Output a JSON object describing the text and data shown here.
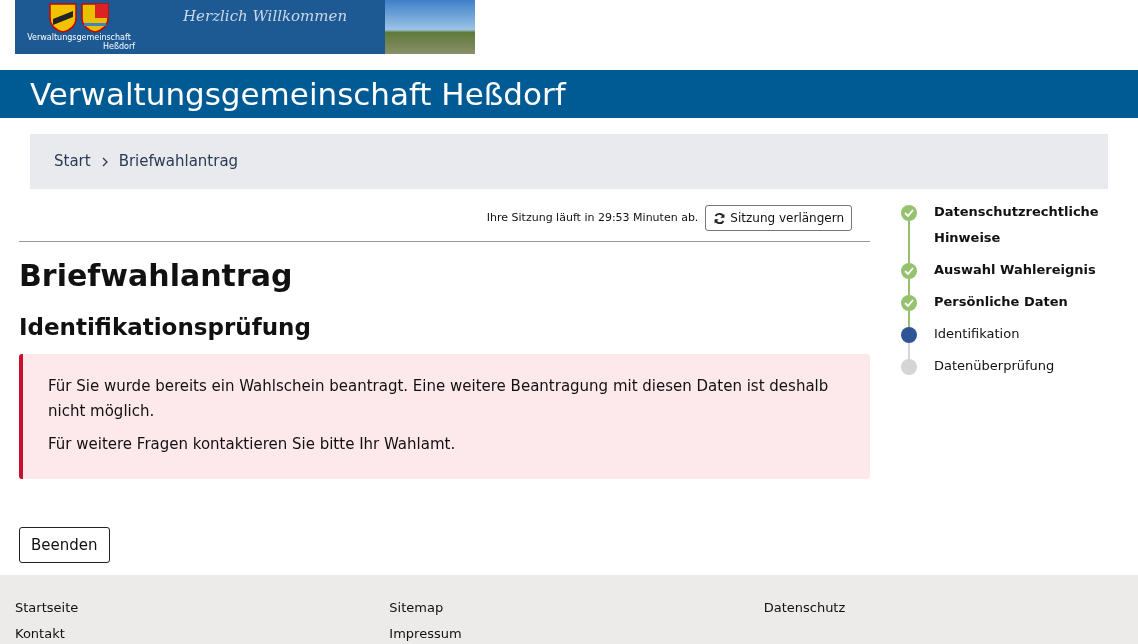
{
  "banner": {
    "caption_top": "Verwaltungsgemeinschaft",
    "caption_bottom": "Heßdorf",
    "greeting": "Herzlich Willkommen"
  },
  "site_title": "Verwaltungsgemeinschaft Heßdorf",
  "breadcrumb": [
    {
      "label": "Start"
    },
    {
      "label": "Briefwahlantrag"
    }
  ],
  "session": {
    "text": "Ihre Sitzung läuft in 29:53 Minuten ab.",
    "button": "Sitzung verlängern"
  },
  "heading": "Briefwahlantrag",
  "subheading": "Identifikationsprüfung",
  "alert": {
    "paragraphs": [
      "Für Sie wurde bereits ein Wahlschein beantragt. Eine weitere Beantragung mit diesen Daten ist deshalb nicht möglich.",
      "Für weitere Fragen kontaktieren Sie bitte Ihr Wahlamt."
    ]
  },
  "finish_button": "Beenden",
  "steps": [
    {
      "label": "Datenschutzrechtliche Hinweise",
      "completed": true,
      "selected": false
    },
    {
      "label": "Auswahl Wahlereignis",
      "completed": true,
      "selected": false
    },
    {
      "label": "Persönliche Daten",
      "completed": true,
      "selected": false
    },
    {
      "label": "Identifikation",
      "completed": false,
      "selected": true
    },
    {
      "label": "Datenüberprüfung",
      "completed": false,
      "selected": false
    }
  ],
  "footer": [
    [
      "Startseite",
      "Kontakt"
    ],
    [
      "Sitemap",
      "Impressum"
    ],
    [
      "Datenschutz"
    ]
  ]
}
